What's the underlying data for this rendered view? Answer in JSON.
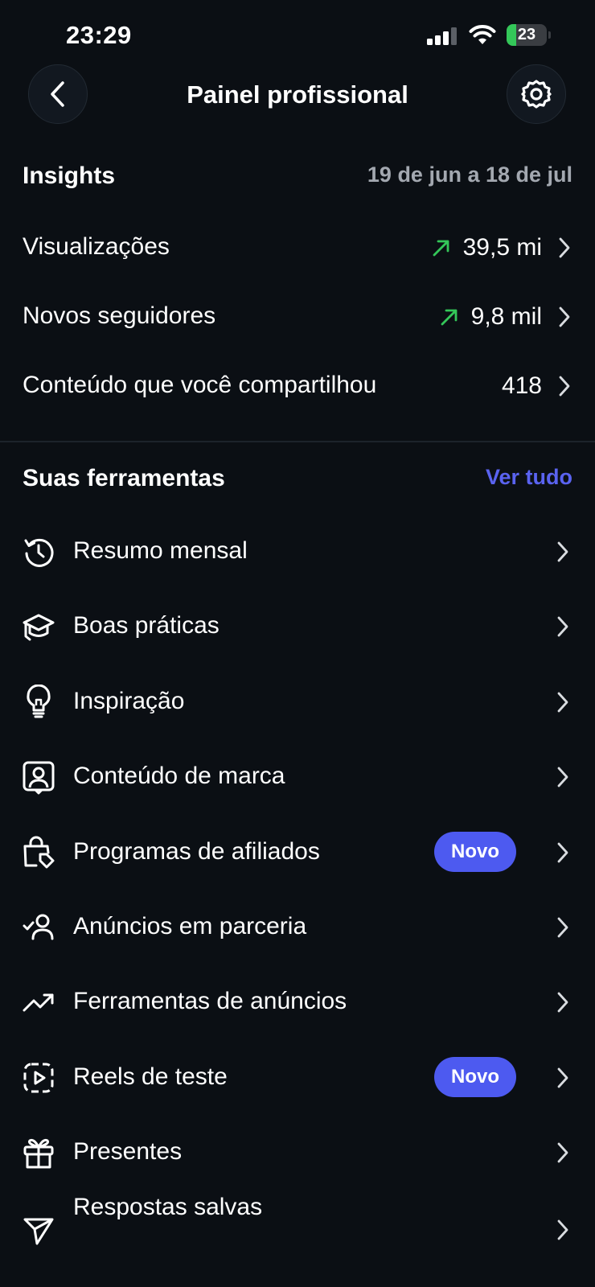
{
  "status_bar": {
    "time": "23:29",
    "battery_level": "23",
    "battery_fraction": 0.23,
    "battery_color": "#34c759"
  },
  "nav": {
    "title": "Painel profissional",
    "back_icon": "chevron-left-icon",
    "settings_icon": "gear-icon"
  },
  "insights": {
    "title": "Insights",
    "date_range": "19 de jun a 18 de jul",
    "metrics": [
      {
        "label": "Visualizações",
        "value": "39,5 mi",
        "trend": "up"
      },
      {
        "label": "Novos seguidores",
        "value": "9,8 mil",
        "trend": "up"
      },
      {
        "label": "Conteúdo que você compartilhou",
        "value": "418",
        "trend": "none"
      }
    ],
    "trend_color": "#34c759"
  },
  "tools": {
    "title": "Suas ferramentas",
    "see_all": "Ver tudo",
    "accent_color": "#5a63f0",
    "badge_color": "#4d5af0",
    "items": [
      {
        "label": "Resumo mensal",
        "icon": "history-icon"
      },
      {
        "label": "Boas práticas",
        "icon": "graduation-cap-icon"
      },
      {
        "label": "Inspiração",
        "icon": "lightbulb-icon"
      },
      {
        "label": "Conteúdo de marca",
        "icon": "branded-content-icon"
      },
      {
        "label": "Programas de afiliados",
        "icon": "shopping-bag-tag-icon",
        "badge": "Novo"
      },
      {
        "label": "Anúncios em parceria",
        "icon": "user-check-icon"
      },
      {
        "label": "Ferramentas de anúncios",
        "icon": "trending-up-icon"
      },
      {
        "label": "Reels de teste",
        "icon": "reels-play-icon",
        "badge": "Novo"
      },
      {
        "label": "Presentes",
        "icon": "gift-icon"
      },
      {
        "label": "Respostas salvas",
        "icon": "send-icon"
      }
    ]
  }
}
